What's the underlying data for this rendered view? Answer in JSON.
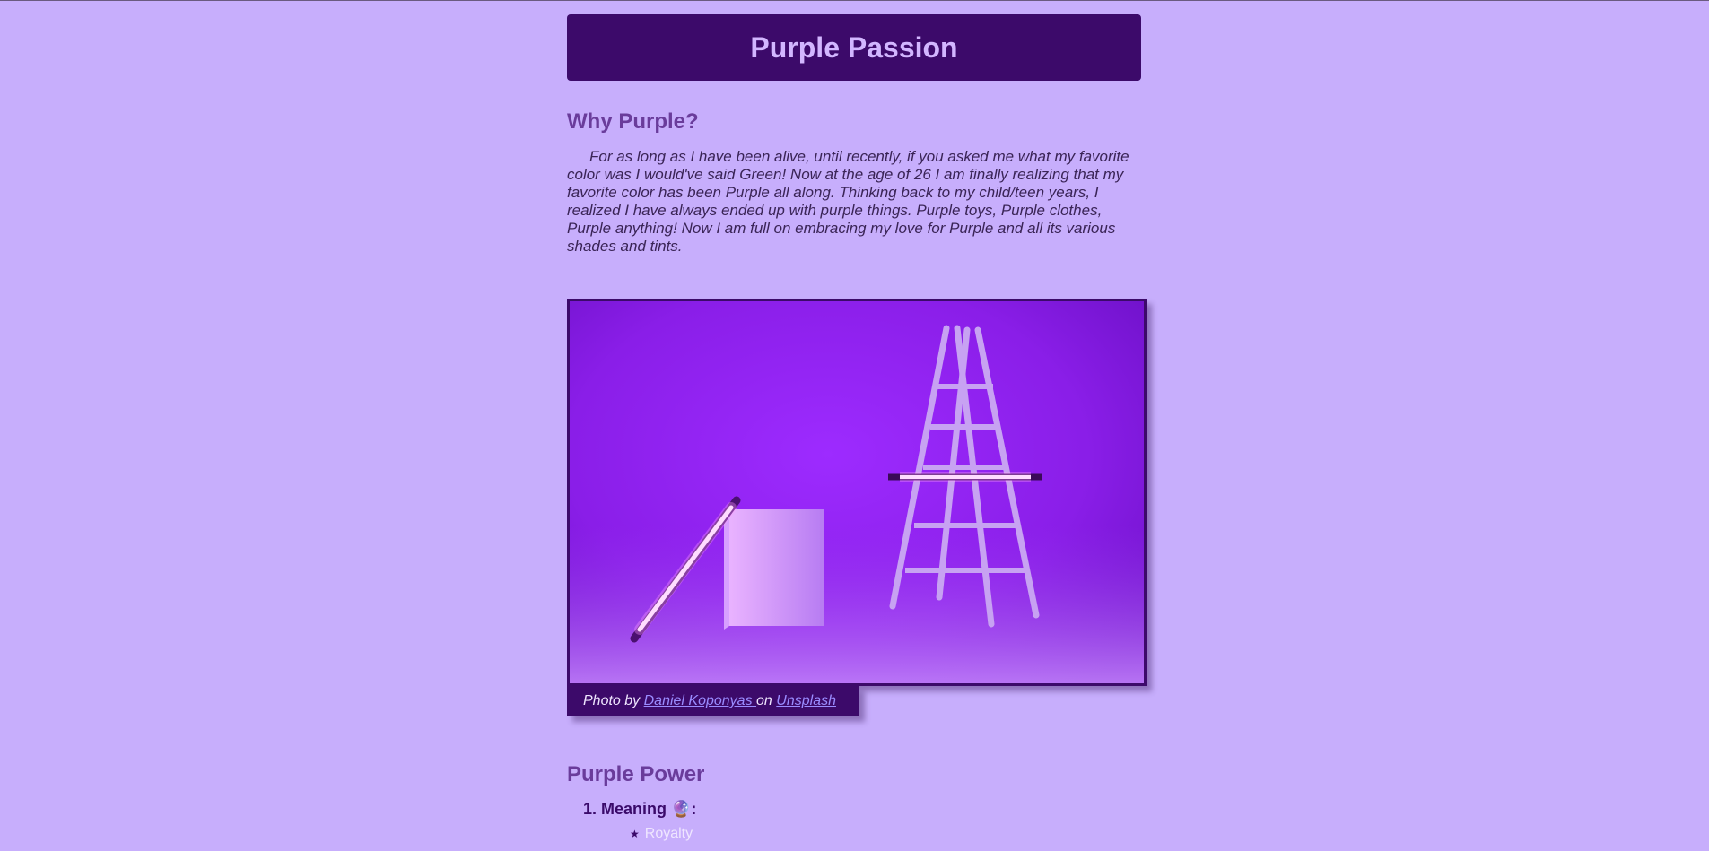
{
  "header": {
    "title": "Purple Passion"
  },
  "why": {
    "heading": "Why Purple?",
    "paragraph": "For as long as I have been alive, until recently, if you asked me what my favorite color was I would've said Green! Now at the age of 26 I am finally realizing that my favorite color has been Purple all along. Thinking back to my child/teen years, I realized I have always ended up with purple things. Purple toys, Purple clothes, Purple anything! Now I am full on embracing my love for Purple and all its various shades and tints."
  },
  "photo": {
    "caption_prefix": "Photo by ",
    "author": "Daniel Koponyas ",
    "caption_mid": "on ",
    "source": "Unsplash"
  },
  "power": {
    "heading": "Purple Power",
    "items": [
      {
        "label": "Meaning 🔮:",
        "subitems": [
          "Royalty"
        ]
      }
    ]
  },
  "colors": {
    "background": "#c7aefc",
    "banner": "#3c0a6a",
    "heading": "#6a3c9b",
    "link": "#9a8cff"
  },
  "icons": [
    "crystal-ball-icon",
    "star-bullet-icon"
  ]
}
